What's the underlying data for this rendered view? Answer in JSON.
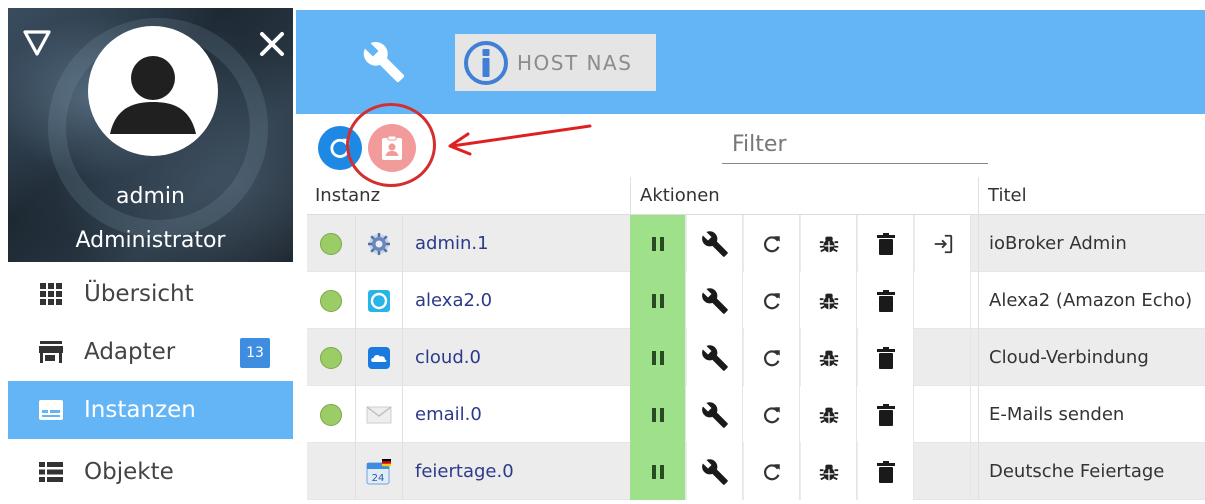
{
  "sidebar": {
    "user_name": "admin",
    "user_role": "Administrator",
    "items": [
      {
        "label": "Übersicht",
        "icon": "grid-icon"
      },
      {
        "label": "Adapter",
        "icon": "store-icon",
        "badge": "13"
      },
      {
        "label": "Instanzen",
        "icon": "card-icon",
        "active": true
      },
      {
        "label": "Objekte",
        "icon": "list-icon"
      }
    ]
  },
  "topbar": {
    "host_label": "HOST NAS"
  },
  "toolbar": {
    "filter_placeholder": "Filter"
  },
  "table": {
    "headers": {
      "instance": "Instanz",
      "actions": "Aktionen",
      "title": "Titel"
    },
    "rows": [
      {
        "name": "admin.1",
        "title": "ioBroker Admin",
        "status": "green",
        "icon": "gear-icon",
        "has_login": true
      },
      {
        "name": "alexa2.0",
        "title": "Alexa2 (Amazon Echo)",
        "status": "green",
        "icon": "alexa-icon",
        "has_login": false
      },
      {
        "name": "cloud.0",
        "title": "Cloud-Verbindung",
        "status": "green",
        "icon": "cloud-icon",
        "has_login": false
      },
      {
        "name": "email.0",
        "title": "E-Mails senden",
        "status": "green",
        "icon": "envelope-icon",
        "has_login": false
      },
      {
        "name": "feiertage.0",
        "title": "Deutsche Feiertage",
        "status": "none",
        "icon": "calendar-icon",
        "has_login": false
      }
    ],
    "calendar_day": "24"
  },
  "colors": {
    "accent": "#64b5f6",
    "nav_active": "#64b5f6",
    "pause_green": "#9fe08a",
    "status_green": "#9ccc65",
    "highlight_red": "#d32f2f"
  }
}
